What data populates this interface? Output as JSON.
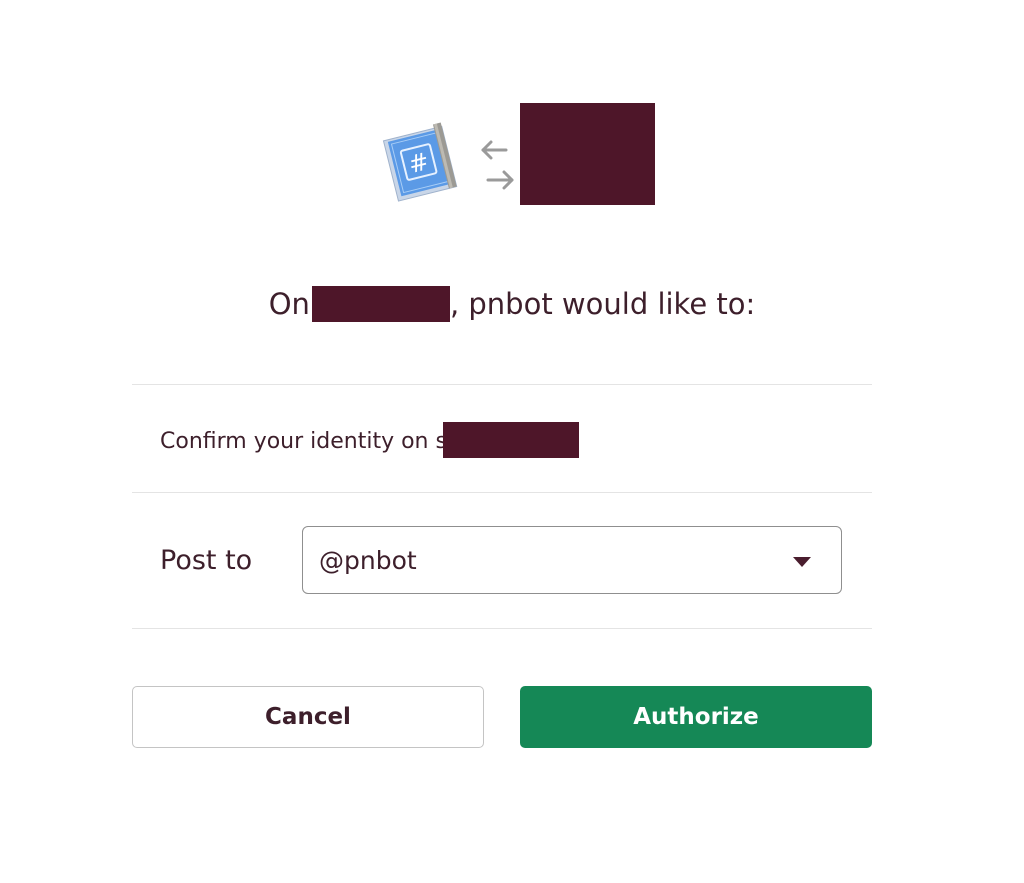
{
  "header": {
    "app_icon": "slack-app-hash-icon",
    "exchange_icon": "exchange-arrows-icon",
    "workspace_icon": "workspace-avatar-redacted"
  },
  "heading": {
    "prefix": "On",
    "suffix": ", pnbot would like to:"
  },
  "permissions": {
    "identity_text": "Confirm your identity on s"
  },
  "post_to": {
    "label": "Post to",
    "selected": "@pnbot"
  },
  "buttons": {
    "cancel": "Cancel",
    "authorize": "Authorize"
  },
  "colors": {
    "accent": "#158856",
    "redaction": "#4e1629",
    "text": "#3d1f2b"
  }
}
